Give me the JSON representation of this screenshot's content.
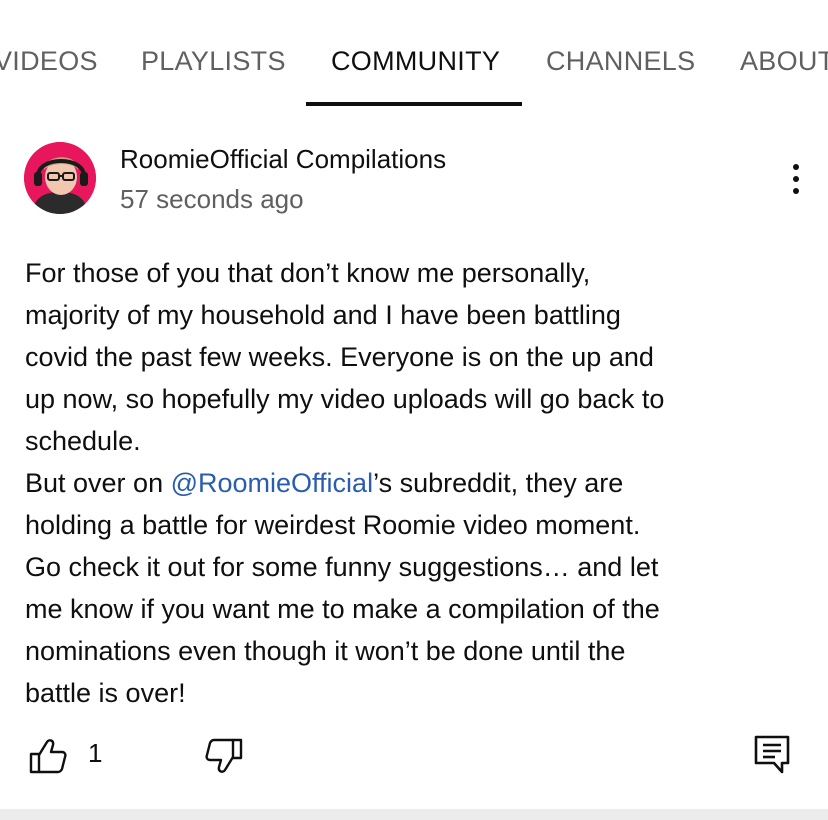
{
  "tabs": [
    {
      "label": "VIDEOS",
      "active": false
    },
    {
      "label": "PLAYLISTS",
      "active": false
    },
    {
      "label": "COMMUNITY",
      "active": true
    },
    {
      "label": "CHANNELS",
      "active": false
    },
    {
      "label": "ABOUT",
      "active": false
    }
  ],
  "post": {
    "channel_name": "RoomieOfficial Compilations",
    "timestamp": "57 seconds ago",
    "text": {
      "line1": "For those of you that don’t know me personally,",
      "line2": "majority of my household and I have been battling",
      "line3": "covid the past few weeks. Everyone is on the up and",
      "line4": "up now, so hopefully my video uploads will go back to",
      "line5": "schedule.",
      "line6_before": "But over on ",
      "mention": "@RoomieOfficial",
      "line6_after": "’s subreddit, they are",
      "line7": "holding a battle for weirdest Roomie video moment.",
      "line8": "Go check it out for some funny suggestions… and let",
      "line9": "me know if you want me to make a compilation of the",
      "line10": "nominations even though it won’t be done until the",
      "line11": "battle is over!"
    },
    "like_count": "1"
  },
  "icons": {
    "more": "more-vert-icon",
    "like": "thumbs-up-icon",
    "dislike": "thumbs-down-icon",
    "comment": "comment-icon"
  },
  "colors": {
    "mention": "#2a5db0",
    "avatar_background": "#e8175d",
    "secondary_text": "#606060"
  }
}
